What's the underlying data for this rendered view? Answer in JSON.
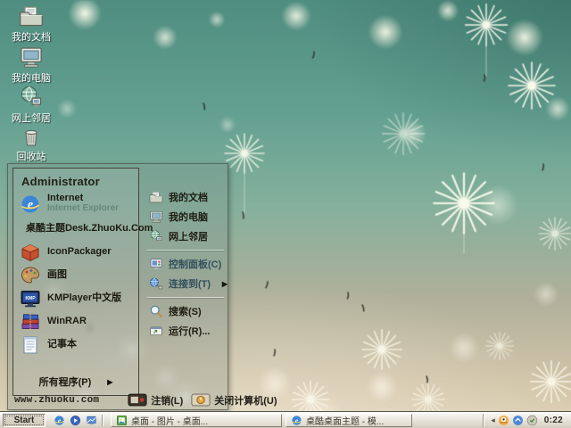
{
  "desktop": {
    "icons": [
      {
        "label": "我的文档",
        "icon": "my-documents-icon"
      },
      {
        "label": "我的电脑",
        "icon": "my-computer-icon"
      },
      {
        "label": "网上邻居",
        "icon": "network-places-icon"
      },
      {
        "label": "回收站",
        "icon": "recycle-bin-icon"
      }
    ]
  },
  "start_menu": {
    "user": "Administrator",
    "left_items": [
      {
        "label": "Internet",
        "sublabel": "Internet Explorer",
        "icon": "internet-explorer-icon"
      },
      {
        "label": "桌酷主题Desk.ZhuoKu.Com",
        "icon": "zhuoku-theme-icon"
      },
      {
        "label": "IconPackager",
        "icon": "iconpackager-icon"
      },
      {
        "label": "画图",
        "icon": "paint-icon"
      },
      {
        "label": "KMPlayer中文版",
        "icon": "kmplayer-icon"
      },
      {
        "label": "WinRAR",
        "icon": "winrar-icon"
      },
      {
        "label": "记事本",
        "icon": "notepad-icon"
      }
    ],
    "all_programs_label": "所有程序(P)",
    "submenu_arrow": "▶",
    "right_items": [
      {
        "label": "我的文档",
        "icon": "my-documents-icon"
      },
      {
        "label": "我的电脑",
        "icon": "my-computer-icon"
      },
      {
        "label": "网上邻居",
        "icon": "network-places-icon"
      },
      {
        "label": "控制面板(C)",
        "icon": "control-panel-icon"
      },
      {
        "label": "连接到(T)",
        "icon": "connect-to-icon",
        "submenu": true
      },
      {
        "label": "搜索(S)",
        "icon": "search-icon"
      },
      {
        "label": "运行(R)...",
        "icon": "run-icon"
      }
    ],
    "footer": {
      "website": "www.zhuoku.com",
      "log_off_label": "注销(L)",
      "turn_off_label": "关闭计算机(U)"
    }
  },
  "taskbar": {
    "start_label": "Start",
    "quick_launch": [
      {
        "icon": "internet-explorer-icon"
      },
      {
        "icon": "media-player-icon"
      },
      {
        "icon": "show-desktop-icon"
      }
    ],
    "tasks": [
      {
        "label": "桌面 - 图片 - 桌面...",
        "icon": "image-viewer-icon"
      },
      {
        "label": "桌酷桌面主题 - 模...",
        "icon": "internet-explorer-icon"
      }
    ],
    "tray": {
      "chevron": "◂",
      "icons": [
        "qq-icon",
        "messenger-icon",
        "status-icon"
      ],
      "time": "0:22"
    }
  },
  "wallpaper": {
    "theme": "dandelion-bokeh",
    "colors": {
      "teal": "#5a9c8c",
      "sage": "#8fb39f",
      "beige": "#d3c5ac",
      "puff": "#fffdf0"
    }
  }
}
